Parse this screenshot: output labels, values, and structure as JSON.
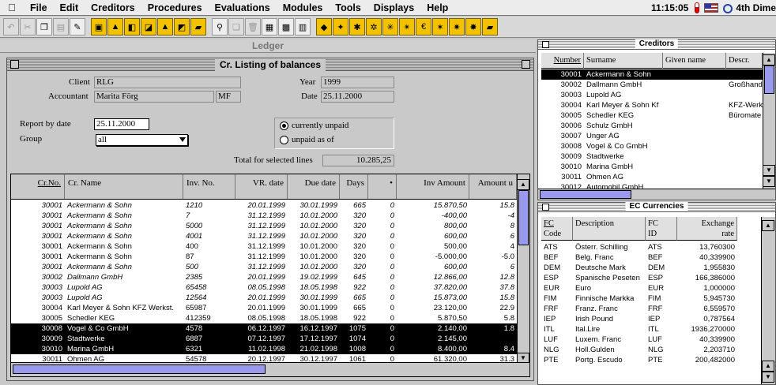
{
  "menubar": {
    "items": [
      "File",
      "Edit",
      "Creditors",
      "Procedures",
      "Evaluations",
      "Modules",
      "Tools",
      "Displays",
      "Help"
    ],
    "clock": "11:15:05",
    "app_name": "4th Dime"
  },
  "ledger": {
    "window_title": "Ledger",
    "dialog_title": "Cr. Listing of balances",
    "client_label": "Client",
    "client_value": "RLG",
    "accountant_label": "Accountant",
    "accountant_value": "Marita Förg",
    "accountant_code": "MF",
    "year_label": "Year",
    "year_value": "1999",
    "date_label": "Date",
    "date_value": "25.11.2000",
    "report_by_date_label": "Report by date",
    "report_by_date_value": "25.11.2000",
    "group_label": "Group",
    "group_value": "all",
    "radio_currently_unpaid": "currently unpaid",
    "radio_unpaid_as_of": "unpaid as of",
    "total_label": "Total for selected lines",
    "total_value": "10.285,25",
    "columns": [
      "Cr.No.",
      "Cr. Name",
      "Inv. No.",
      "VR. date",
      "Due date",
      "Days",
      "•",
      "Inv Amount",
      "Amount u"
    ],
    "rows": [
      {
        "no": "30001",
        "name": "Ackermann & Sohn",
        "inv": "1210",
        "vr": "20.01.1999",
        "due": "30.01.1999",
        "days": "665",
        "dot": "0",
        "amount": "15.870,50",
        "amount_u": "15.8",
        "italic": true,
        "selected": false
      },
      {
        "no": "30001",
        "name": "Ackermann & Sohn",
        "inv": "7",
        "vr": "31.12.1999",
        "due": "10.01.2000",
        "days": "320",
        "dot": "0",
        "amount": "-400,00",
        "amount_u": "-4",
        "italic": true,
        "selected": false
      },
      {
        "no": "30001",
        "name": "Ackermann & Sohn",
        "inv": "5000",
        "vr": "31.12.1999",
        "due": "10.01.2000",
        "days": "320",
        "dot": "0",
        "amount": "800,00",
        "amount_u": "8",
        "italic": true,
        "selected": false
      },
      {
        "no": "30001",
        "name": "Ackermann & Sohn",
        "inv": "4001",
        "vr": "31.12.1999",
        "due": "10.01.2000",
        "days": "320",
        "dot": "0",
        "amount": "600,00",
        "amount_u": "6",
        "italic": true,
        "selected": false
      },
      {
        "no": "30001",
        "name": "Ackermann & Sohn",
        "inv": "400",
        "vr": "31.12.1999",
        "due": "10.01.2000",
        "days": "320",
        "dot": "0",
        "amount": "500,00",
        "amount_u": "4",
        "italic": false,
        "selected": false
      },
      {
        "no": "30001",
        "name": "Ackermann & Sohn",
        "inv": "87",
        "vr": "31.12.1999",
        "due": "10.01.2000",
        "days": "320",
        "dot": "0",
        "amount": "-5.000,00",
        "amount_u": "-5.0",
        "italic": false,
        "selected": false
      },
      {
        "no": "30001",
        "name": "Ackermann & Sohn",
        "inv": "500",
        "vr": "31.12.1999",
        "due": "10.01.2000",
        "days": "320",
        "dot": "0",
        "amount": "600,00",
        "amount_u": "6",
        "italic": true,
        "selected": false
      },
      {
        "no": "30002",
        "name": "Dallmann GmbH",
        "inv": "2385",
        "vr": "20.01.1999",
        "due": "19.02.1999",
        "days": "645",
        "dot": "0",
        "amount": "12.866,00",
        "amount_u": "12.8",
        "italic": true,
        "selected": false
      },
      {
        "no": "30003",
        "name": "Lupold AG",
        "inv": "65458",
        "vr": "08.05.1998",
        "due": "18.05.1998",
        "days": "922",
        "dot": "0",
        "amount": "37.820,00",
        "amount_u": "37.8",
        "italic": true,
        "selected": false
      },
      {
        "no": "30003",
        "name": "Lupold AG",
        "inv": "12564",
        "vr": "20.01.1999",
        "due": "30.01.1999",
        "days": "665",
        "dot": "0",
        "amount": "15.873,00",
        "amount_u": "15.8",
        "italic": true,
        "selected": false
      },
      {
        "no": "30004",
        "name": "Karl Meyer & Sohn KFZ Werkst.",
        "inv": "65987",
        "vr": "20.01.1999",
        "due": "30.01.1999",
        "days": "665",
        "dot": "0",
        "amount": "23.120,00",
        "amount_u": "22.9",
        "italic": false,
        "selected": false
      },
      {
        "no": "30005",
        "name": "Schedler KEG",
        "inv": "412359",
        "vr": "08.05.1998",
        "due": "18.05.1998",
        "days": "922",
        "dot": "0",
        "amount": "5.870,50",
        "amount_u": "5.8",
        "italic": false,
        "selected": false
      },
      {
        "no": "30008",
        "name": "Vogel & Co GmbH",
        "inv": "4578",
        "vr": "06.12.1997",
        "due": "16.12.1997",
        "days": "1075",
        "dot": "0",
        "amount": "2.140,00",
        "amount_u": "1.8",
        "italic": false,
        "selected": true
      },
      {
        "no": "30009",
        "name": "Stadtwerke",
        "inv": "6887",
        "vr": "07.12.1997",
        "due": "17.12.1997",
        "days": "1074",
        "dot": "0",
        "amount": "2.145,00",
        "amount_u": "",
        "italic": false,
        "selected": true
      },
      {
        "no": "30010",
        "name": "Marina GmbH",
        "inv": "6321",
        "vr": "11.02.1998",
        "due": "21.02.1998",
        "days": "1008",
        "dot": "0",
        "amount": "8.400,00",
        "amount_u": "8.4",
        "italic": false,
        "selected": true
      },
      {
        "no": "30011",
        "name": "Ohmen AG",
        "inv": "54578",
        "vr": "20.12.1997",
        "due": "30.12.1997",
        "days": "1061",
        "dot": "0",
        "amount": "61.320,00",
        "amount_u": "31.3",
        "italic": false,
        "selected": false
      }
    ]
  },
  "creditors": {
    "title": "Creditors",
    "columns": [
      "Number",
      "Surname",
      "Given name",
      "Descr."
    ],
    "rows": [
      {
        "no": "30001",
        "surname": "Ackermann & Sohn",
        "given": "",
        "descr": "",
        "selected": true
      },
      {
        "no": "30002",
        "surname": "Dallmann GmbH",
        "given": "",
        "descr": "Großhande",
        "selected": false
      },
      {
        "no": "30003",
        "surname": "Lupold AG",
        "given": "",
        "descr": "",
        "selected": false
      },
      {
        "no": "30004",
        "surname": "Karl Meyer & Sohn Kf",
        "given": "",
        "descr": "KFZ-Werk",
        "selected": false
      },
      {
        "no": "30005",
        "surname": "Schedler KEG",
        "given": "",
        "descr": "Büromate",
        "selected": false
      },
      {
        "no": "30006",
        "surname": "Schulz GmbH",
        "given": "",
        "descr": "",
        "selected": false
      },
      {
        "no": "30007",
        "surname": "Unger AG",
        "given": "",
        "descr": "",
        "selected": false
      },
      {
        "no": "30008",
        "surname": "Vogel & Co GmbH",
        "given": "",
        "descr": "",
        "selected": false
      },
      {
        "no": "30009",
        "surname": "Stadtwerke",
        "given": "",
        "descr": "",
        "selected": false
      },
      {
        "no": "30010",
        "surname": "Marina GmbH",
        "given": "",
        "descr": "",
        "selected": false
      },
      {
        "no": "30011",
        "surname": "Ohmen AG",
        "given": "",
        "descr": "",
        "selected": false
      },
      {
        "no": "30012",
        "surname": "Automobil GmbH",
        "given": "",
        "descr": "",
        "selected": false
      }
    ]
  },
  "currencies": {
    "title": "EC Currencies",
    "columns": [
      "FC Code",
      "Description",
      "FC ID",
      "Exchange rate"
    ],
    "col_fc_code_1": "FC",
    "col_fc_code_2": "Code",
    "col_fc_id_1": "FC",
    "col_fc_id_2": "ID",
    "col_rate_1": "Exchange",
    "col_rate_2": "rate",
    "rows": [
      {
        "code": "ATS",
        "desc": "Österr. Schilling",
        "id": "ATS",
        "rate": "13,760300"
      },
      {
        "code": "BEF",
        "desc": "Belg. Franc",
        "id": "BEF",
        "rate": "40,339900"
      },
      {
        "code": "DEM",
        "desc": "Deutsche Mark",
        "id": "DEM",
        "rate": "1,955830"
      },
      {
        "code": "ESP",
        "desc": "Spanische Peseten",
        "id": "ESP",
        "rate": "166,386000"
      },
      {
        "code": "EUR",
        "desc": "Euro",
        "id": "EUR",
        "rate": "1,000000"
      },
      {
        "code": "FIM",
        "desc": "Finnische Markka",
        "id": "FIM",
        "rate": "5,945730"
      },
      {
        "code": "FRF",
        "desc": "Franz. Franc",
        "id": "FRF",
        "rate": "6,559570"
      },
      {
        "code": "IEP",
        "desc": "Irish Pound",
        "id": "IEP",
        "rate": "0,787564"
      },
      {
        "code": "ITL",
        "desc": "Ital.Lire",
        "id": "ITL",
        "rate": "1936,270000"
      },
      {
        "code": "LUF",
        "desc": "Luxem. Franc",
        "id": "LUF",
        "rate": "40,339900"
      },
      {
        "code": "NLG",
        "desc": "Holl.Gulden",
        "id": "NLG",
        "rate": "2,203710"
      },
      {
        "code": "PTE",
        "desc": "Portg. Escudo",
        "id": "PTE",
        "rate": "200,482000"
      }
    ]
  },
  "colors": {
    "selection": "#000000",
    "scroll_thumb": "#9999ee",
    "toolbar_accent": "#f2c200"
  }
}
